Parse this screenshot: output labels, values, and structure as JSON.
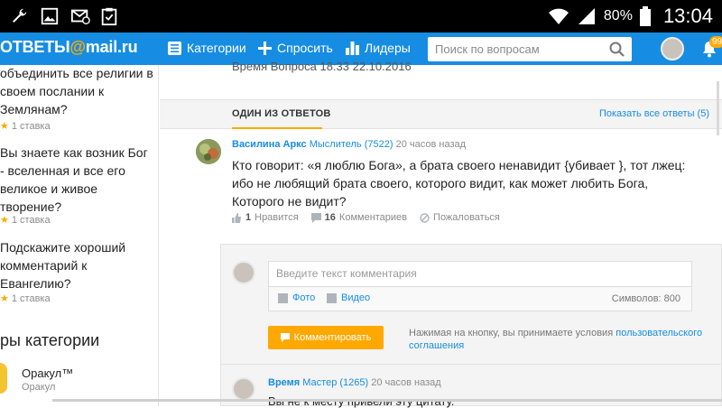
{
  "status_bar": {
    "battery": "80%",
    "time": "13:04",
    "icons": [
      "wrench-icon",
      "image-icon",
      "mail-muted-icon",
      "clipboard-icon",
      "wifi-icon",
      "signal-icon",
      "battery-icon"
    ]
  },
  "nav": {
    "logo_prefix": "ОТВЕТЫ",
    "logo_at": "@",
    "logo_domain": "mail.ru",
    "links": [
      "Категории",
      "Спросить",
      "Лидеры"
    ],
    "search_placeholder": "Поиск по вопросам",
    "notifications_badge": "99"
  },
  "sidebar": {
    "questions": [
      {
        "text": "объединить все религии в своем послании к Землянам?",
        "stake": "1 ставка"
      },
      {
        "text": "Вы знаете как возник Бог - вселенная и все его великое и живое творение?",
        "stake": "1 ставка"
      },
      {
        "text": "Подскажите хороший комментарий к Евангелию?",
        "stake": "1 ставка"
      }
    ],
    "categories_heading": "ры категории",
    "oracle": {
      "name": "Оракул™",
      "subtitle": "Оракул"
    }
  },
  "main": {
    "cut_text": "Время Вопроса 18:33 22.10.2016",
    "tab_label": "ОДИН ИЗ ОТВЕТОВ",
    "show_all": "Показать все ответы (5)",
    "answer": {
      "author": "Василина Аркс",
      "rank": "Мыслитель (7522)",
      "time": "20 часов назад",
      "text": "Кто говорит: «я люблю Бога», а брата своего ненавидит {убивает }, тот лжец: ибо не любящий брата своего, которого видит, как может любить Бога, Которого не видит?",
      "likes": "1",
      "likes_label": "Нравится",
      "comments": "16",
      "comments_label": "Комментариев",
      "complain_label": "Пожаловаться"
    },
    "comment_form": {
      "placeholder": "Введите текст комментария",
      "photo_label": "Фото",
      "video_label": "Видео",
      "char_count": "Символов: 800",
      "button_label": "Комментировать",
      "terms_prefix": "Нажимая на кнопку, вы принимаете условия",
      "terms_link": "пользовательского соглашения"
    },
    "comment": {
      "author": "Время",
      "rank": "Мастер (1265)",
      "time": "20 часов назад",
      "text": "Вы не к месту привели эту цитату."
    }
  }
}
